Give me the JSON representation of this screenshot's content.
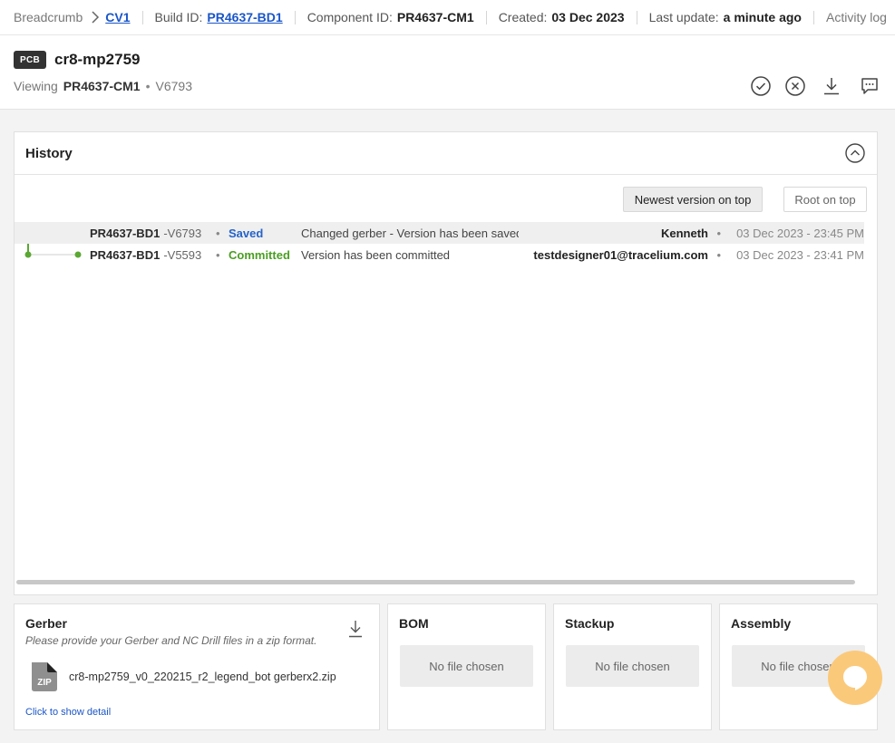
{
  "topbar": {
    "breadcrumb": "Breadcrumb",
    "breadcrumb_current": "CV1",
    "build_label": "Build ID:",
    "build_id": "PR4637-BD1",
    "component_label": "Component ID:",
    "component_id": "PR4637-CM1",
    "created_label": "Created:",
    "created_value": "03 Dec 2023",
    "update_label": "Last update:",
    "update_value": "a minute ago",
    "activity_log": "Activity log"
  },
  "header": {
    "badge": "PCB",
    "title": "cr8-mp2759",
    "viewing_label": "Viewing",
    "viewing_id": "PR4637-CM1",
    "viewing_dot": "•",
    "viewing_version": "V6793"
  },
  "history": {
    "title": "History",
    "sort_newest": "Newest version on top",
    "sort_root": "Root on top",
    "rows": [
      {
        "name": "PR4637-BD1",
        "version": "-V6793",
        "bullet": "•",
        "status": "Saved",
        "status_color": "#2563c9",
        "message": "Changed gerber - Version has been saved",
        "user": "Kenneth",
        "date": "03 Dec 2023 - 23:45 PM"
      },
      {
        "name": "PR4637-BD1",
        "version": "-V5593",
        "bullet": "•",
        "status": "Committed",
        "status_color": "#4a9e22",
        "message": "Version has been committed",
        "user": "testdesigner01@tracelium.com",
        "date": "03 Dec 2023 - 23:41 PM"
      }
    ]
  },
  "cards": {
    "gerber": {
      "title": "Gerber",
      "description": "Please provide your Gerber and NC Drill files in a zip format.",
      "zip_label": "ZIP",
      "file_name": "cr8-mp2759_v0_220215_r2_legend_bot gerberx2.zip",
      "detail_link": "Click to show detail"
    },
    "bom": {
      "title": "BOM",
      "empty": "No file chosen"
    },
    "stackup": {
      "title": "Stackup",
      "empty": "No file chosen"
    },
    "assembly": {
      "title": "Assembly",
      "empty": "No file chosen"
    }
  },
  "colors": {
    "accent_link": "#1a56c8",
    "tree_green": "#5aa832",
    "chat_bubble": "#fbc97a"
  }
}
